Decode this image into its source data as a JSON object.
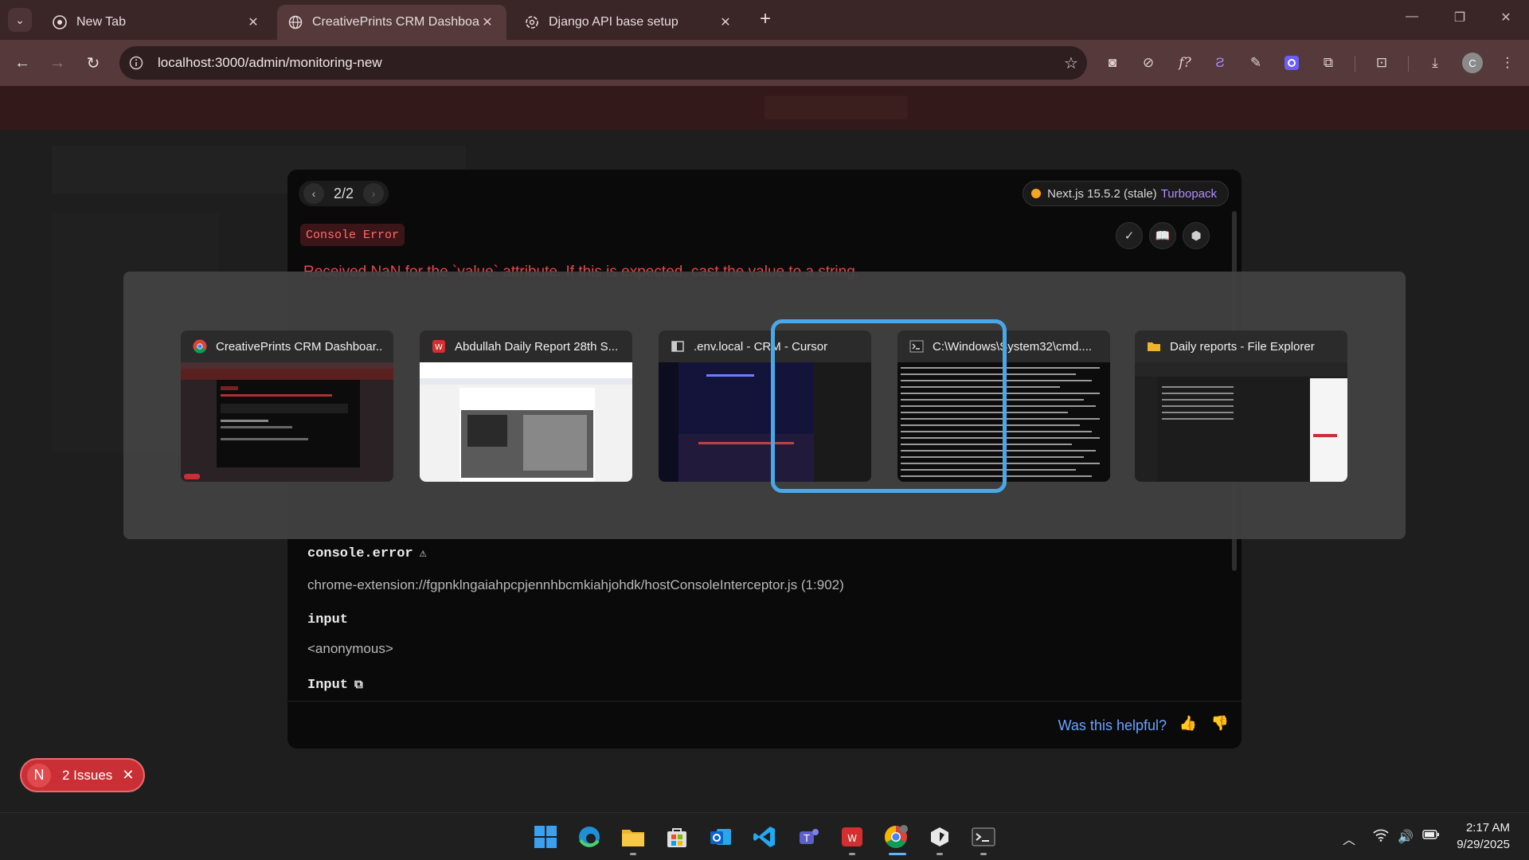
{
  "browser": {
    "tabs": [
      {
        "title": "New Tab",
        "favicon": "chrome-icon",
        "active": false
      },
      {
        "title": "CreativePrints CRM Dashboard",
        "favicon": "globe-icon",
        "active": true
      },
      {
        "title": "Django API base setup",
        "favicon": "openai-icon",
        "active": false
      }
    ],
    "url": "localhost:3000/admin/monitoring-new",
    "profile_initial": "C"
  },
  "overlay": {
    "pager": "2/2",
    "version_label": "Next.js 15.5.2 (stale)",
    "bundler": "Turbopack",
    "error_type": "Console Error",
    "error_message": "Received NaN for the `value` attribute. If this is expected, cast the value to a string.",
    "stack_title": "console.error",
    "stack_path": "chrome-extension://fgpnklngaiahpcpjennhbcmkiahjohdk/hostConsoleInterceptor.js (1:902)",
    "frame1_name": "input",
    "frame1_loc": "<anonymous>",
    "frame2_name": "Input",
    "helpful_prompt": "Was this helpful?"
  },
  "issues": {
    "initial": "N",
    "label": "2 Issues"
  },
  "switcher": {
    "windows": [
      {
        "title": "CreativePrints CRM Dashboar...",
        "icon": "chrome-icon",
        "selected": false
      },
      {
        "title": "Abdullah Daily Report 28th S...",
        "icon": "wps-writer-icon",
        "selected": false
      },
      {
        "title": ".env.local - CRM - Cursor",
        "icon": "cursor-icon",
        "selected": true
      },
      {
        "title": "C:\\Windows\\System32\\cmd....",
        "icon": "terminal-icon",
        "selected": false
      },
      {
        "title": "Daily reports - File Explorer",
        "icon": "folder-icon",
        "selected": false
      }
    ]
  },
  "taskbar": {
    "apps": [
      "start-icon",
      "edge-icon",
      "file-explorer-icon",
      "store-icon",
      "outlook-icon",
      "vscode-icon",
      "teams-icon",
      "wps-icon",
      "chrome-icon",
      "cursor-icon",
      "terminal-icon"
    ],
    "time": "2:17 AM",
    "date": "9/29/2025"
  },
  "colors": {
    "accent": "#4aa8e8",
    "error": "#e5484d",
    "browser_frame": "#55393b"
  }
}
